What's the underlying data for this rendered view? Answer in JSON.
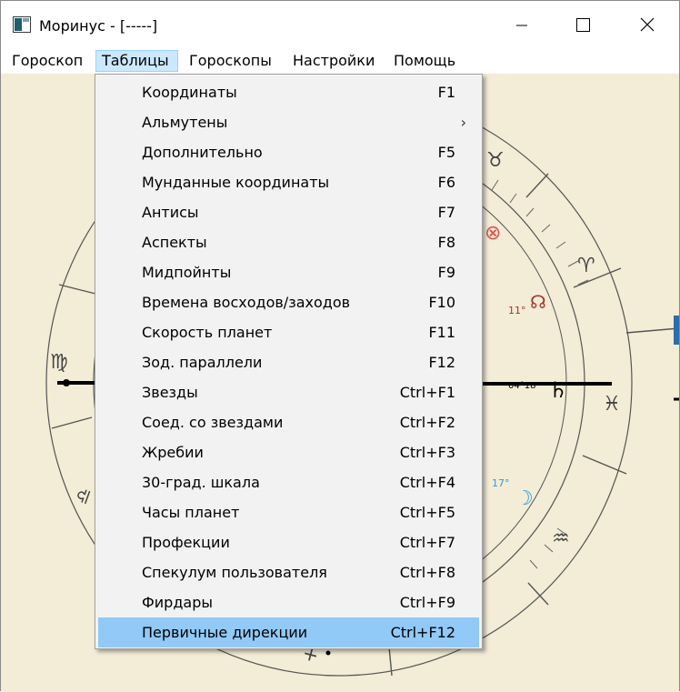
{
  "window": {
    "title": "Моринус - [-----]",
    "controls": {
      "minimize": "–",
      "maximize": "☐",
      "close": "✕"
    }
  },
  "menubar": {
    "items": [
      {
        "label": "Гороскоп",
        "active": false
      },
      {
        "label": "Таблицы",
        "active": true
      },
      {
        "label": "Гороскопы",
        "active": false
      },
      {
        "label": "Настройки",
        "active": false
      },
      {
        "label": "Помощь",
        "active": false
      }
    ]
  },
  "dropdown": {
    "items": [
      {
        "label": "Координаты",
        "shortcut": "F1"
      },
      {
        "label": "Альмутены",
        "shortcut": "",
        "submenu": true
      },
      {
        "label": "Дополнительно",
        "shortcut": "F5"
      },
      {
        "label": "Мунданные координаты",
        "shortcut": "F6"
      },
      {
        "label": "Антисы",
        "shortcut": "F7"
      },
      {
        "label": "Аспекты",
        "shortcut": "F8"
      },
      {
        "label": "Мидпойнты",
        "shortcut": "F9"
      },
      {
        "label": "Времена восходов/заходов",
        "shortcut": "F10"
      },
      {
        "label": "Скорость планет",
        "shortcut": "F11"
      },
      {
        "label": "Зод. параллели",
        "shortcut": "F12"
      },
      {
        "label": "Звезды",
        "shortcut": "Ctrl+F1"
      },
      {
        "label": "Соед. со звездами",
        "shortcut": "Ctrl+F2"
      },
      {
        "label": "Жребии",
        "shortcut": "Ctrl+F3"
      },
      {
        "label": "30-град. шкала",
        "shortcut": "Ctrl+F4"
      },
      {
        "label": "Часы планет",
        "shortcut": "Ctrl+F5"
      },
      {
        "label": "Профекции",
        "shortcut": "Ctrl+F7"
      },
      {
        "label": "Спекулум пользователя",
        "shortcut": "Ctrl+F8"
      },
      {
        "label": "Фирдары",
        "shortcut": "Ctrl+F9"
      },
      {
        "label": "Первичные дирекции",
        "shortcut": "Ctrl+F12",
        "highlighted": true
      }
    ],
    "submenu_arrow": "›"
  },
  "chart_glyphs": {
    "taurus": "♉",
    "aries": "♈",
    "pisces": "♓",
    "aquarius": "♒",
    "virgo": "♍",
    "libra": "♎",
    "node": "☊",
    "saturn": "♄",
    "moon": "☽",
    "fortune": "⊗",
    "node_label": "11°",
    "moon_label": "17°",
    "saturn_label": "04°18'"
  },
  "colors": {
    "canvas_bg": "#f3ecd6",
    "menu_bg": "#f2f2f2",
    "highlight": "#91c9f7",
    "active_menu": "#cce8ff",
    "node_red": "#a5332d",
    "fortune_red": "#d9534f",
    "moon_blue": "#2a9fd8"
  }
}
